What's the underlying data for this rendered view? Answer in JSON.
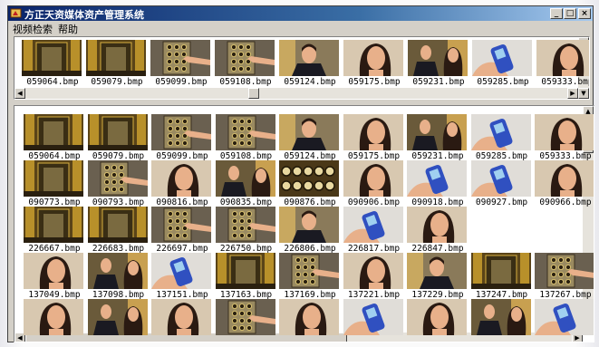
{
  "window": {
    "title": "方正天资媒体资产管理系统",
    "app_icon": "app-logo-icon"
  },
  "title_buttons": {
    "minimize": "_",
    "maximize": "□",
    "close": "×"
  },
  "menu": [
    {
      "label": "视频检索"
    },
    {
      "label": "帮助"
    }
  ],
  "scroll_glyphs": {
    "left": "◀",
    "right": "▶",
    "up": "▲",
    "down": "▼"
  },
  "strip": [
    {
      "label": "059064.bmp",
      "kind": "elevator"
    },
    {
      "label": "059079.bmp",
      "kind": "elevator"
    },
    {
      "label": "059099.bmp",
      "kind": "panel-hand"
    },
    {
      "label": "059108.bmp",
      "kind": "panel-hand"
    },
    {
      "label": "059124.bmp",
      "kind": "man"
    },
    {
      "label": "059175.bmp",
      "kind": "woman"
    },
    {
      "label": "059231.bmp",
      "kind": "man-woman"
    },
    {
      "label": "059285.bmp",
      "kind": "phone"
    },
    {
      "label": "059333.bmp",
      "kind": "woman"
    }
  ],
  "grid": [
    [
      {
        "label": "059064.bmp",
        "kind": "elevator"
      },
      {
        "label": "059079.bmp",
        "kind": "elevator"
      },
      {
        "label": "059099.bmp",
        "kind": "panel-hand"
      },
      {
        "label": "059108.bmp",
        "kind": "panel-hand"
      },
      {
        "label": "059124.bmp",
        "kind": "man"
      },
      {
        "label": "059175.bmp",
        "kind": "woman"
      },
      {
        "label": "059231.bmp",
        "kind": "man-woman"
      },
      {
        "label": "059285.bmp",
        "kind": "phone"
      },
      {
        "label": "059333.bmp",
        "kind": "woman"
      }
    ],
    [
      {
        "label": "090773.bmp",
        "kind": "elevator"
      },
      {
        "label": "090793.bmp",
        "kind": "panel-hand"
      },
      {
        "label": "090816.bmp",
        "kind": "woman"
      },
      {
        "label": "090835.bmp",
        "kind": "man-woman"
      },
      {
        "label": "090876.bmp",
        "kind": "buttons"
      },
      {
        "label": "090906.bmp",
        "kind": "woman"
      },
      {
        "label": "090918.bmp",
        "kind": "phone"
      },
      {
        "label": "090927.bmp",
        "kind": "phone"
      },
      {
        "label": "090966.bmp",
        "kind": "woman"
      }
    ],
    [
      {
        "label": "226667.bmp",
        "kind": "elevator"
      },
      {
        "label": "226683.bmp",
        "kind": "elevator"
      },
      {
        "label": "226697.bmp",
        "kind": "panel-hand"
      },
      {
        "label": "226750.bmp",
        "kind": "panel-hand"
      },
      {
        "label": "226806.bmp",
        "kind": "man"
      },
      {
        "label": "226817.bmp",
        "kind": "phone"
      },
      {
        "label": "226847.bmp",
        "kind": "woman"
      }
    ],
    [
      {
        "label": "137049.bmp",
        "kind": "woman"
      },
      {
        "label": "137098.bmp",
        "kind": "man-woman"
      },
      {
        "label": "137151.bmp",
        "kind": "phone"
      },
      {
        "label": "137163.bmp",
        "kind": "elevator"
      },
      {
        "label": "137169.bmp",
        "kind": "panel-hand"
      },
      {
        "label": "137221.bmp",
        "kind": "woman"
      },
      {
        "label": "137229.bmp",
        "kind": "man"
      },
      {
        "label": "137247.bmp",
        "kind": "elevator"
      },
      {
        "label": "137267.bmp",
        "kind": "panel-hand"
      }
    ],
    [
      {
        "label": "",
        "kind": "woman"
      },
      {
        "label": "",
        "kind": "man-woman"
      },
      {
        "label": "",
        "kind": "woman"
      },
      {
        "label": "",
        "kind": "panel-hand"
      },
      {
        "label": "",
        "kind": "woman"
      },
      {
        "label": "",
        "kind": "phone"
      },
      {
        "label": "",
        "kind": "woman"
      },
      {
        "label": "",
        "kind": "man-woman"
      },
      {
        "label": "",
        "kind": "phone"
      }
    ]
  ]
}
